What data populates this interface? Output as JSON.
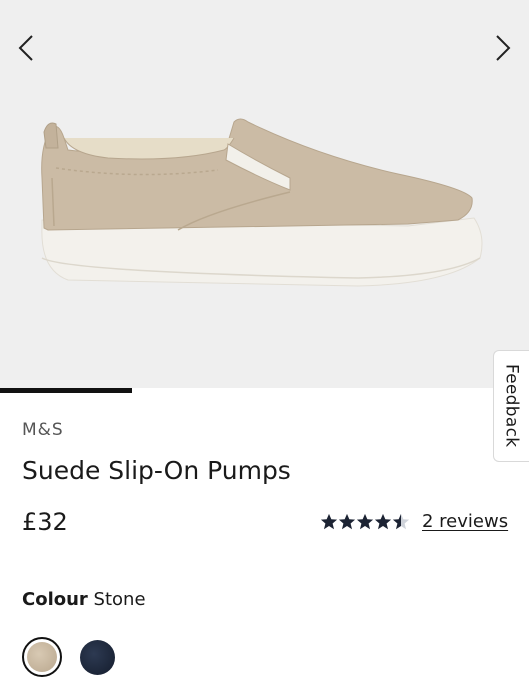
{
  "gallery": {
    "prev_icon": "chevron-left-icon",
    "next_icon": "chevron-right-icon",
    "image_alt": "Suede slip-on pump in stone",
    "progress_fraction": 0.25
  },
  "feedback": {
    "label": "Feedback"
  },
  "product": {
    "brand": "M&S",
    "title": "Suede Slip-On Pumps",
    "price": "£32",
    "rating": {
      "value": 4.5,
      "max": 5,
      "reviews_label": "2 reviews"
    },
    "colour": {
      "label": "Colour",
      "selected": "Stone",
      "swatches": [
        {
          "name": "Stone",
          "color": "#c9b9a1",
          "selected": true
        },
        {
          "name": "Navy",
          "color": "#1c2538",
          "selected": false
        }
      ]
    }
  },
  "colors": {
    "gallery_bg": "#efefef",
    "text": "#1a1a1a",
    "brand_text": "#555555"
  }
}
